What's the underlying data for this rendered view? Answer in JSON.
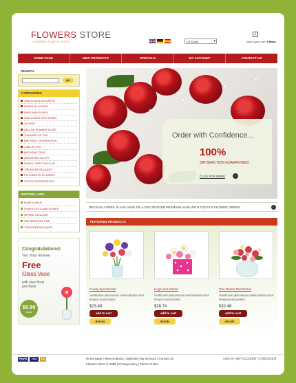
{
  "logo": {
    "word1": "FLOWERS",
    "word2": "STORE",
    "tagline": "Flowers. Plants. Gifts."
  },
  "header": {
    "currency": "US Dollar",
    "cart_prefix": "Now in your cart",
    "cart_count": "0 items"
  },
  "nav": [
    "Home page",
    "New products",
    "Specials",
    "My account",
    "Contact us"
  ],
  "search": {
    "title": "Search",
    "go_label": "go"
  },
  "categories": {
    "title": "Categories",
    "items": [
      "One Dozen Assorted",
      "Roses in 12 Free",
      "Pure and Roses",
      "One Dozen Red Roses",
      "12 Free",
      "Deluxe Summer Lilies",
      "Thinking of You",
      "Birthday Celebration",
      "Jubilee Iris",
      "Birthday Cear",
      "Assorted Tulips",
      "Purely Spectacular",
      "Treasure Bouquet",
      "Pictures in Flowers",
      "Joyful Expressions"
    ]
  },
  "bestsellers": {
    "title": "Bestsellers",
    "items": [
      "Make a Wish",
      "Poker Dots and Posies",
      "Spring Sunlight",
      "Celebration Time",
      "Treasure Bouquet"
    ]
  },
  "promo": {
    "congrats": "Congratulations!",
    "receive": "You may receive",
    "free": "Free",
    "glass": "Glass Vase",
    "with": "with your floral purchase",
    "price": "$9.99",
    "value": "value"
  },
  "hero": {
    "line1": "Order with Confidence...",
    "line2": "100%",
    "line3": "Satisfaction Guaranteed",
    "more": "Click for more",
    "more_icon": "›"
  },
  "offer": {
    "text": "Receive a free glass vase or a discounted premium vase with today's flower order",
    "icon": "›"
  },
  "featured": {
    "title": "Featured products",
    "products": [
      {
        "name": "Purely Spectacular",
        "desc": "Vestibulum placeramus euismodassa mrus tempus euismodanti.",
        "price": "$23.45",
        "add": "add to cart",
        "details": "details"
      },
      {
        "name": "Hugs and Kisses",
        "desc": "Vestibulum placeramus euismodassa mrus tempus euismodanti.",
        "price": "$28.74",
        "add": "add to cart",
        "details": "details"
      },
      {
        "name": "One Dozen Red Roses",
        "desc": "Vestibulum placeramus euismodassa mrus tempus euismodanti.",
        "price": "$32.46",
        "add": "add to cart",
        "details": "details"
      }
    ]
  },
  "footer": {
    "pay": [
      "PayPal",
      "VISA",
      "MC"
    ],
    "links": "Home page  |  New products  |  Specials  |  My account  |  Contact us",
    "copy": "Flowers Store © 2008  |  Privacy policy  |  Terms of Use",
    "right": "Log in  |  My account  |  Checkout"
  }
}
